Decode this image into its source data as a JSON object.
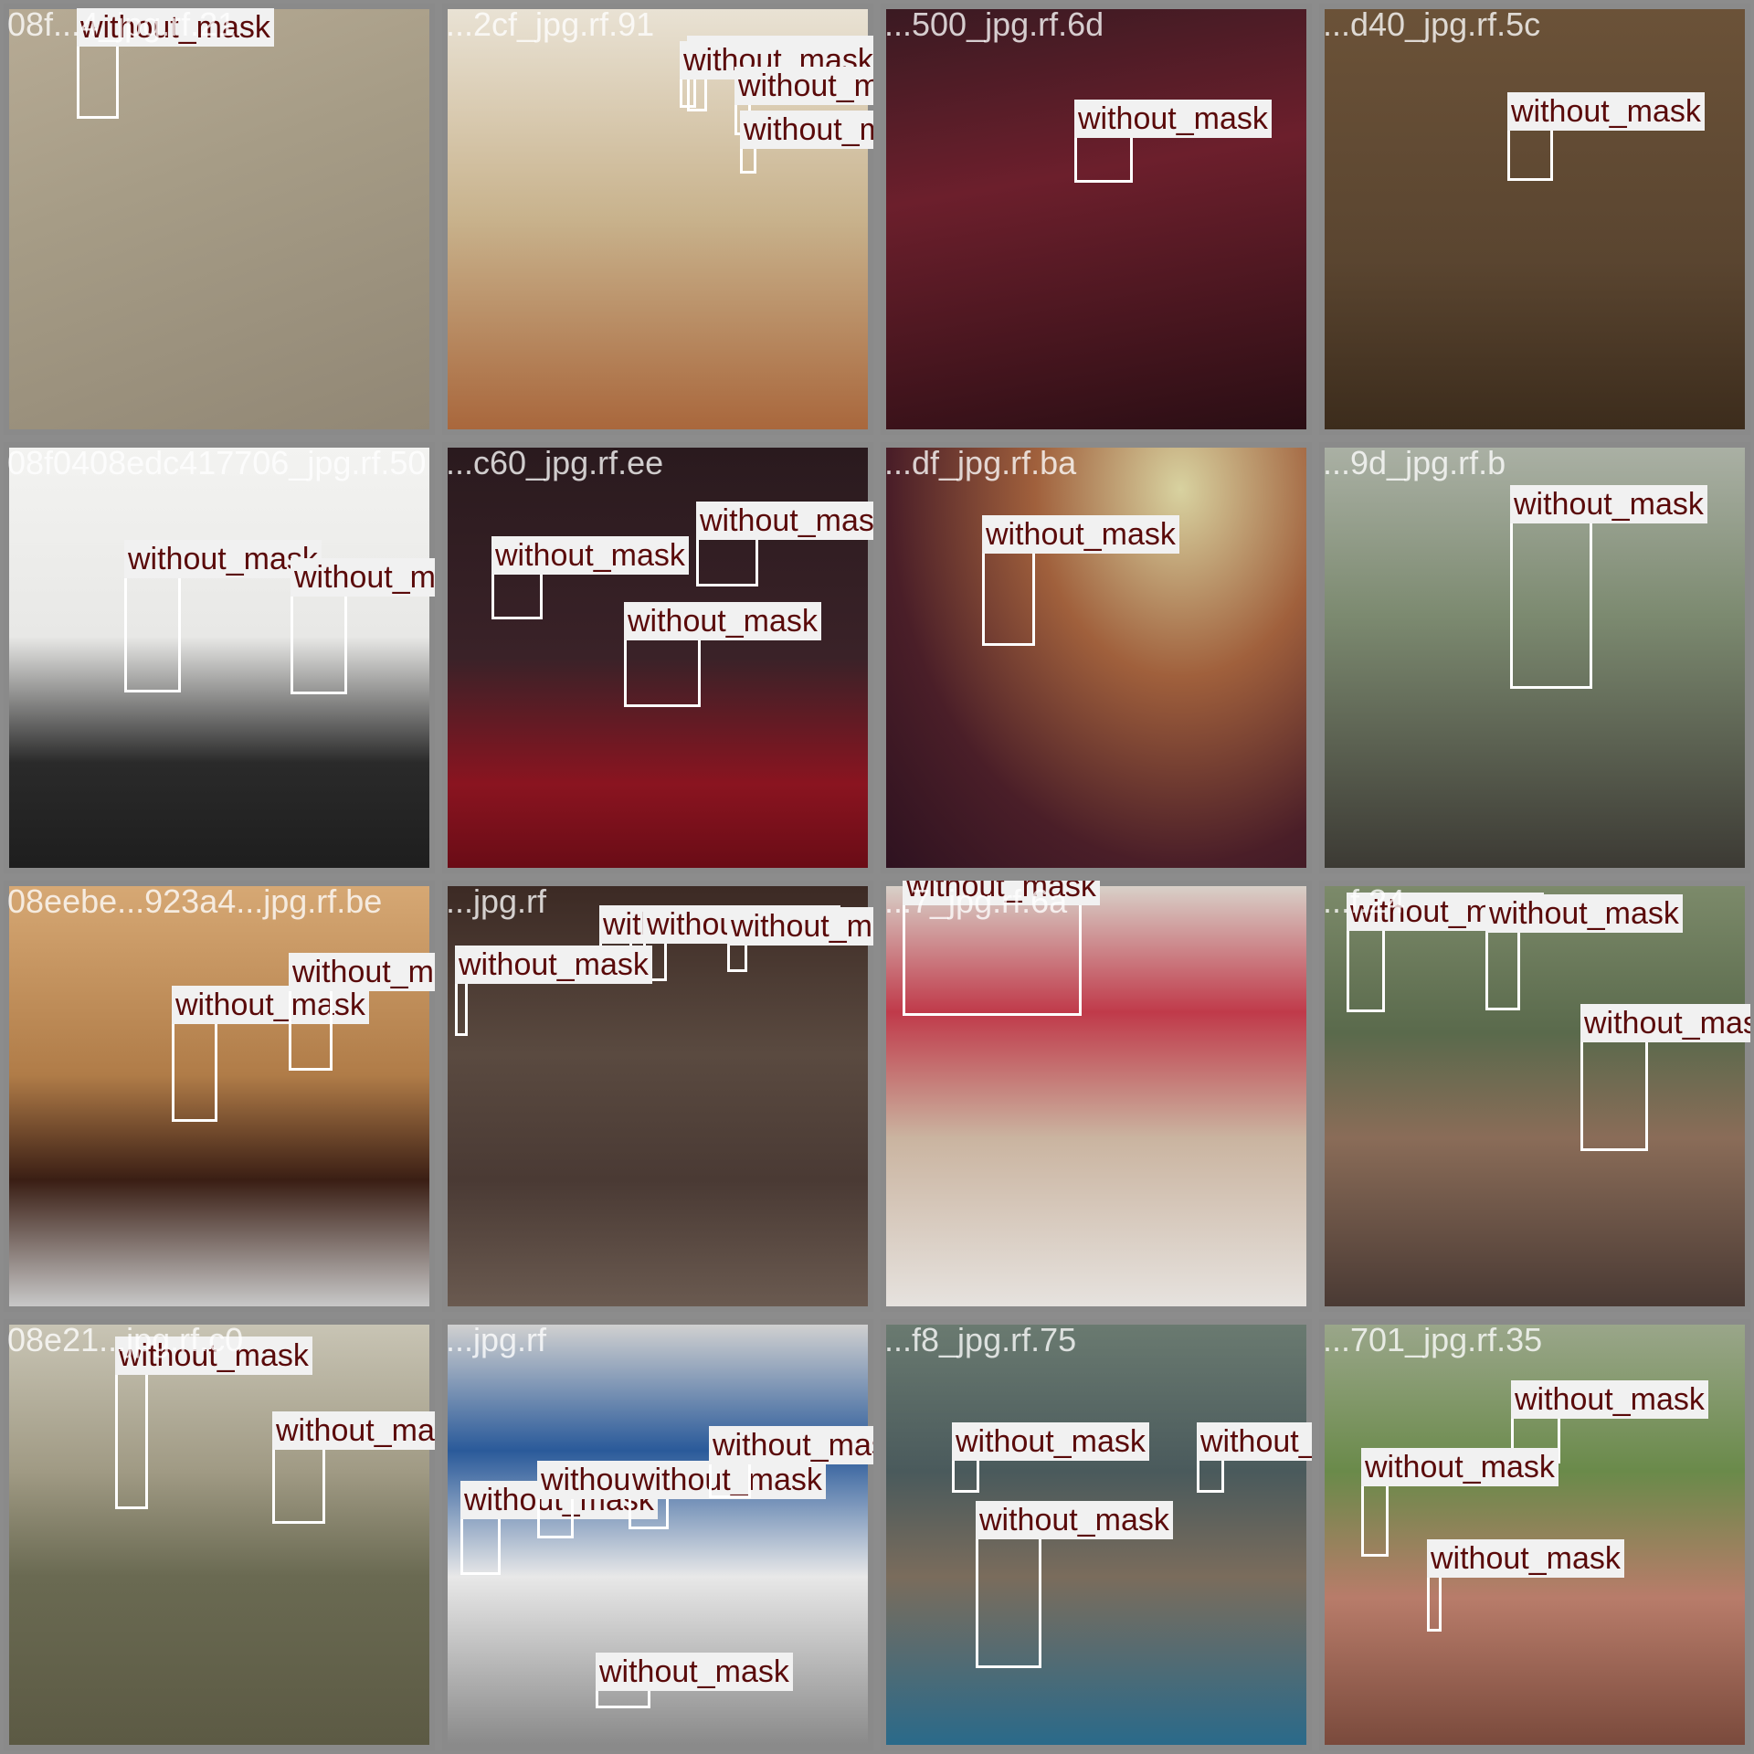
{
  "class_label": "without_mask",
  "colors": {
    "label_text": "#5a0a0a",
    "label_bg": "#f1f1f1",
    "box": "#ffffff",
    "separator": "#8a8a8a"
  },
  "tiles": [
    {
      "filename": "08f...4_jpg.rf.21",
      "bg": "linear-gradient(160deg,#b7ab95 0%,#a69c86 40%,#918775 100%)",
      "boxes": [
        {
          "l": 74,
          "t": 38,
          "w": 46,
          "h": 82
        },
        {
          "l": 130,
          "t": 62,
          "w": 0,
          "h": 0
        }
      ]
    },
    {
      "filename": "...2cf_jpg.rf.91",
      "bg": "linear-gradient(180deg,#e9e2d4 0%,#c8b28c 50%,#a9673c 100%)",
      "boxes": [
        {
          "l": 262,
          "t": 68,
          "w": 22,
          "h": 44
        },
        {
          "l": 254,
          "t": 74,
          "w": 18,
          "h": 34
        },
        {
          "l": 314,
          "t": 102,
          "w": 18,
          "h": 36
        },
        {
          "l": 320,
          "t": 150,
          "w": 18,
          "h": 30
        }
      ]
    },
    {
      "filename": "...500_jpg.rf.6d",
      "bg": "linear-gradient(170deg,#3a1a22 0%,#6c1f2c 40%,#2a0e14 100%)",
      "boxes": [
        {
          "l": 206,
          "t": 138,
          "w": 64,
          "h": 52
        }
      ]
    },
    {
      "filename": "...d40_jpg.rf.5c",
      "bg": "linear-gradient(180deg,#6b5238 0%,#5a4530 60%,#3c2c1c 100%)",
      "boxes": [
        {
          "l": 200,
          "t": 130,
          "w": 50,
          "h": 58
        }
      ]
    },
    {
      "filename": "08f0408edc417706_jpg.rf.50",
      "bg": "linear-gradient(180deg,#f3f3f1 0%,#e8e8e6 45%,#2a2a2a 75%,#1e1e1e 100%)",
      "boxes": [
        {
          "l": 126,
          "t": 140,
          "w": 62,
          "h": 128
        },
        {
          "l": 308,
          "t": 160,
          "w": 62,
          "h": 110
        }
      ]
    },
    {
      "filename": "...c60_jpg.rf.ee",
      "bg": "linear-gradient(180deg,#2a1a1e 0%,#3a2228 50%,#8a1420 80%,#6a0c16 100%)",
      "boxes": [
        {
          "l": 272,
          "t": 98,
          "w": 68,
          "h": 54
        },
        {
          "l": 48,
          "t": 136,
          "w": 56,
          "h": 52
        },
        {
          "l": 193,
          "t": 208,
          "w": 84,
          "h": 76
        }
      ]
    },
    {
      "filename": "...df_jpg.rf.ba",
      "bg": "radial-gradient(ellipse at 70% 10%,#d8d2a0 0%,#a0603c 35%,#4a1e28 70%,#2e1220 100%)",
      "boxes": [
        {
          "l": 105,
          "t": 113,
          "w": 58,
          "h": 104
        }
      ]
    },
    {
      "filename": "...9d_jpg.rf.b",
      "bg": "linear-gradient(180deg,#aab0a4 0%,#7c8a70 40%,#3c3a34 100%)",
      "boxes": [
        {
          "l": 203,
          "t": 80,
          "w": 90,
          "h": 184
        }
      ]
    },
    {
      "filename": "08eebe...923a4...jpg.rf.be",
      "bg": "linear-gradient(180deg,#d6a874 0%,#b07c48 45%,#3a1e14 70%,#c8c8c8 100%)",
      "boxes": [
        {
          "l": 178,
          "t": 148,
          "w": 50,
          "h": 110
        },
        {
          "l": 306,
          "t": 112,
          "w": 48,
          "h": 90
        }
      ]
    },
    {
      "filename": "...jpg.rf",
      "bg": "linear-gradient(180deg,#3c2a24 0%,#5a4a40 40%,#4a3a34 70%,#6a5a50 100%)",
      "boxes": [
        {
          "l": 166,
          "t": 60,
          "w": 36,
          "h": 44
        },
        {
          "l": 214,
          "t": 60,
          "w": 26,
          "h": 44
        },
        {
          "l": 306,
          "t": 62,
          "w": 22,
          "h": 32
        },
        {
          "l": 8,
          "t": 104,
          "w": 14,
          "h": 60
        }
      ]
    },
    {
      "filename": "...7_jpg.rf.6a",
      "bg": "linear-gradient(180deg,#d8d0c8 0%,#c03a4a 30%,#cab4a0 60%,#e6e2de 100%)",
      "boxes": [
        {
          "l": 18,
          "t": 18,
          "w": 196,
          "h": 124
        }
      ]
    },
    {
      "filename": "...f.24",
      "bg": "linear-gradient(180deg,#7c8a6a 0%,#5a6a4c 35%,#8a6c58 60%,#4a3a34 100%)",
      "boxes": [
        {
          "l": 24,
          "t": 46,
          "w": 42,
          "h": 92
        },
        {
          "l": 176,
          "t": 48,
          "w": 38,
          "h": 88
        },
        {
          "l": 280,
          "t": 168,
          "w": 74,
          "h": 122
        }
      ]
    },
    {
      "filename": "08e21...jpg.rf.c0",
      "bg": "linear-gradient(180deg,#c8c4b4 0%,#a09a84 35%,#6a6a52 60%,#5c5a44 100%)",
      "boxes": [
        {
          "l": 116,
          "t": 52,
          "w": 36,
          "h": 150
        },
        {
          "l": 288,
          "t": 134,
          "w": 58,
          "h": 84
        }
      ]
    },
    {
      "filename": "...jpg.rf",
      "bg": "linear-gradient(180deg,#d0d0d0 0%,#2a5a9a 30%,#e8e8e8 60%,#8a8a8a 100%)",
      "boxes": [
        {
          "l": 14,
          "t": 210,
          "w": 44,
          "h": 64
        },
        {
          "l": 98,
          "t": 188,
          "w": 40,
          "h": 46
        },
        {
          "l": 198,
          "t": 188,
          "w": 44,
          "h": 36
        },
        {
          "l": 286,
          "t": 150,
          "w": 46,
          "h": 40
        },
        {
          "l": 162,
          "t": 398,
          "w": 60,
          "h": 22
        }
      ]
    },
    {
      "filename": "...f8_jpg.rf.75",
      "bg": "linear-gradient(180deg,#6a7a70 0%,#4a5a5c 35%,#7a6c5c 60%,#2a6a8a 100%)",
      "boxes": [
        {
          "l": 98,
          "t": 232,
          "w": 72,
          "h": 144
        },
        {
          "l": 340,
          "t": 146,
          "w": 30,
          "h": 38
        },
        {
          "l": 72,
          "t": 146,
          "w": 30,
          "h": 38
        }
      ]
    },
    {
      "filename": "...701_jpg.rf.35",
      "bg": "linear-gradient(180deg,#9aa68a 0%,#6a8a4a 35%,#b87c6a 65%,#7a4a3c 100%)",
      "boxes": [
        {
          "l": 204,
          "t": 100,
          "w": 54,
          "h": 52
        },
        {
          "l": 40,
          "t": 174,
          "w": 30,
          "h": 80
        },
        {
          "l": 112,
          "t": 274,
          "w": 16,
          "h": 62
        }
      ]
    }
  ]
}
